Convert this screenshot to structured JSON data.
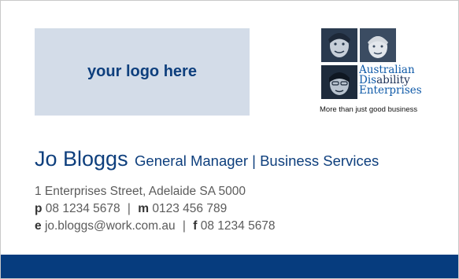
{
  "logo_placeholder": {
    "text": "your logo here",
    "bg": "#d3dce8"
  },
  "ade_logo": {
    "line1": "Australian",
    "line2_prefix": "Dis",
    "line2_suffix": "ability",
    "line3": "Enterprises",
    "tagline": "More than just good business"
  },
  "contact": {
    "name": "Jo Bloggs",
    "title": "General Manager | Business Services",
    "address": "1 Enterprises Street, Adelaide SA 5000",
    "phone_label": "p",
    "phone": "08 1234 5678",
    "mobile_label": "m",
    "mobile": "0123 456 789",
    "email_label": "e",
    "email": "jo.bloggs@work.com.au",
    "fax_label": "f",
    "fax": "08 1234 5678",
    "separator": "|"
  },
  "colors": {
    "brand_navy": "#063c7e",
    "text_blue": "#0e3f7d"
  }
}
